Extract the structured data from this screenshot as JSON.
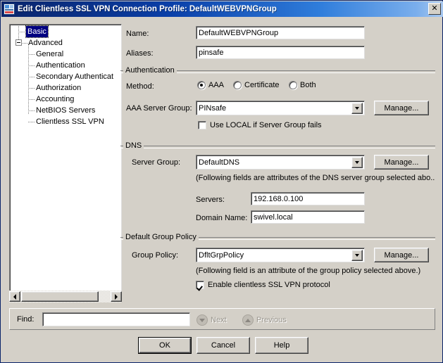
{
  "window": {
    "title": "Edit Clientless SSL VPN Connection Profile: DefaultWEBVPNGroup",
    "icon": "window-profile-icon",
    "close_label": "✕"
  },
  "tree": {
    "nodes": [
      {
        "label": "Basic",
        "selected": true,
        "depth": 1,
        "expander": false
      },
      {
        "label": "Advanced",
        "selected": false,
        "depth": 0,
        "expander": true
      },
      {
        "label": "General",
        "selected": false,
        "depth": 2,
        "expander": false
      },
      {
        "label": "Authentication",
        "selected": false,
        "depth": 2,
        "expander": false
      },
      {
        "label": "Secondary Authenticat",
        "selected": false,
        "depth": 2,
        "expander": false
      },
      {
        "label": "Authorization",
        "selected": false,
        "depth": 2,
        "expander": false
      },
      {
        "label": "Accounting",
        "selected": false,
        "depth": 2,
        "expander": false
      },
      {
        "label": "NetBIOS Servers",
        "selected": false,
        "depth": 2,
        "expander": false
      },
      {
        "label": "Clientless SSL VPN",
        "selected": false,
        "depth": 2,
        "expander": false
      }
    ]
  },
  "form": {
    "name_label": "Name:",
    "name_value": "DefaultWEBVPNGroup",
    "aliases_label": "Aliases:",
    "aliases_value": "pinsafe"
  },
  "authentication": {
    "caption": "Authentication",
    "method_label": "Method:",
    "methods": [
      {
        "label": "AAA",
        "selected": true
      },
      {
        "label": "Certificate",
        "selected": false
      },
      {
        "label": "Both",
        "selected": false
      }
    ],
    "server_group_label": "AAA Server Group:",
    "server_group_value": "PINsafe",
    "manage_label": "Manage...",
    "use_local_label": "Use LOCAL if Server Group fails",
    "use_local_checked": false
  },
  "dns": {
    "caption": "DNS",
    "server_group_label": "Server Group:",
    "server_group_value": "DefaultDNS",
    "manage_label": "Manage...",
    "note": "(Following fields are attributes of the DNS server group selected abo..",
    "servers_label": "Servers:",
    "servers_value": "192.168.0.100",
    "domain_label": "Domain Name:",
    "domain_value": "swivel.local"
  },
  "group_policy": {
    "caption": "Default Group Policy",
    "policy_label": "Group Policy:",
    "policy_value": "DfltGrpPolicy",
    "manage_label": "Manage...",
    "note": "(Following field is an attribute of the group policy selected above.)",
    "enable_label": "Enable clientless SSL VPN protocol",
    "enable_checked": true
  },
  "find": {
    "label": "Find:",
    "value": "",
    "placeholder": "",
    "next_label": "Next",
    "previous_label": "Previous"
  },
  "footer": {
    "ok_label": "OK",
    "cancel_label": "Cancel",
    "help_label": "Help"
  },
  "colors": {
    "dialog_bg": "#d4d0c8",
    "title_start": "#0a246a",
    "title_end": "#a8c8f0",
    "selection": "#000080",
    "field_bg": "#ffffff"
  }
}
